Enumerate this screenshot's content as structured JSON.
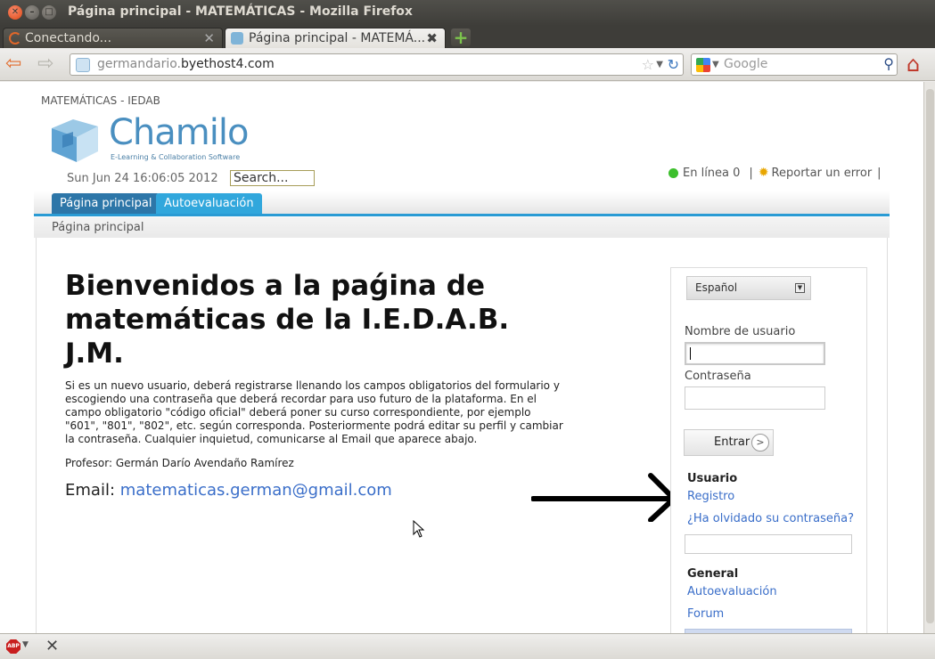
{
  "window": {
    "title": "Página principal - MATEMÁTICAS - Mozilla Firefox"
  },
  "tabs": [
    {
      "label": "Conectando..."
    },
    {
      "label": "Página principal - MATEMÁ..."
    }
  ],
  "navbar": {
    "url_prefix": "germandario.",
    "url_host": "byethost4.com",
    "search_placeholder": "Google"
  },
  "site": {
    "title": "MATEMÁTICAS - IEDAB",
    "logo_word": "Chamilo",
    "logo_tagline": "E-Learning & Collaboration Software",
    "date": "Sun Jun 24 16:06:05 2012",
    "search_value": "Search...",
    "online": "En línea 0",
    "report": "Reportar un error",
    "sep1": "|",
    "sep2": "|",
    "nav_tabs": [
      "Página principal",
      "Autoevaluación"
    ],
    "breadcrumb": "Página principal"
  },
  "main": {
    "headline": "Bienvenidos a la paǵina de matemáticas de la I.E.D.A.B. J.M.",
    "intro": "Si es un nuevo usuario, deberá registrarse llenando los campos obligatorios del formulario y escogiendo una contraseña que deberá recordar para uso futuro de la plataforma. En el campo obligatorio \"código oficial\" deberá poner su curso correspondiente, por ejemplo \"601\", \"801\", \"802\", etc. según corresponda. Posteriormente podrá editar su perfil y cambiar la contraseña. Cualquier inquietud, comunicarse al Email que aparece abajo.",
    "professor": "Profesor: Germán Darío Avendaño Ramírez",
    "email_label": "Email:",
    "email": "matematicas.german@gmail.com"
  },
  "login": {
    "language": "Español",
    "username_label": "Nombre de usuario",
    "password_label": "Contraseña",
    "submit": "Entrar",
    "user_section": "Usuario",
    "register": "Registro",
    "forgot": "¿Ha olvidado su contraseña?",
    "general_section": "General",
    "self_eval": "Autoevaluación",
    "forum": "Forum"
  },
  "colors": {
    "tab_active": "#2d76a8",
    "tab_other": "#31a7dc",
    "link": "#3a6ec9"
  }
}
